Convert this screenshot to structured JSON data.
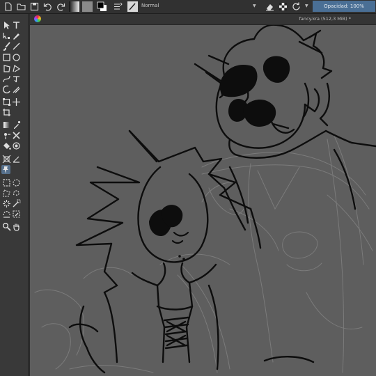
{
  "toolbar": {
    "blend_mode": "Normal",
    "opacity_label": "Opacidad: 100%"
  },
  "document": {
    "title": "fancy.kra (512,3 MiB) *"
  },
  "tools": [
    "select-shapes",
    "text",
    "edit-shapes",
    "calligraphy",
    "freehand-brush",
    "line",
    "rectangle",
    "ellipse",
    "polygon",
    "polyline",
    "bezier",
    "freehand-path",
    "dynamic-brush",
    "multibrush",
    "transform",
    "move",
    "crop",
    "gradient",
    "color-picker",
    "colorize-mask",
    "smart-patch",
    "fill",
    "enclose-fill",
    "assistant",
    "measure",
    "reference-images",
    "rect-select",
    "ellipse-select",
    "polygon-select",
    "freehand-select",
    "contiguous-select",
    "similar-select",
    "bezier-select",
    "magnetic-select",
    "zoom",
    "pan"
  ],
  "colors": {
    "accent": "#4a6f95",
    "canvas": "#5e5e5e",
    "toolbar": "#313131",
    "dock": "#393939",
    "ink": "#0d0d0d"
  }
}
